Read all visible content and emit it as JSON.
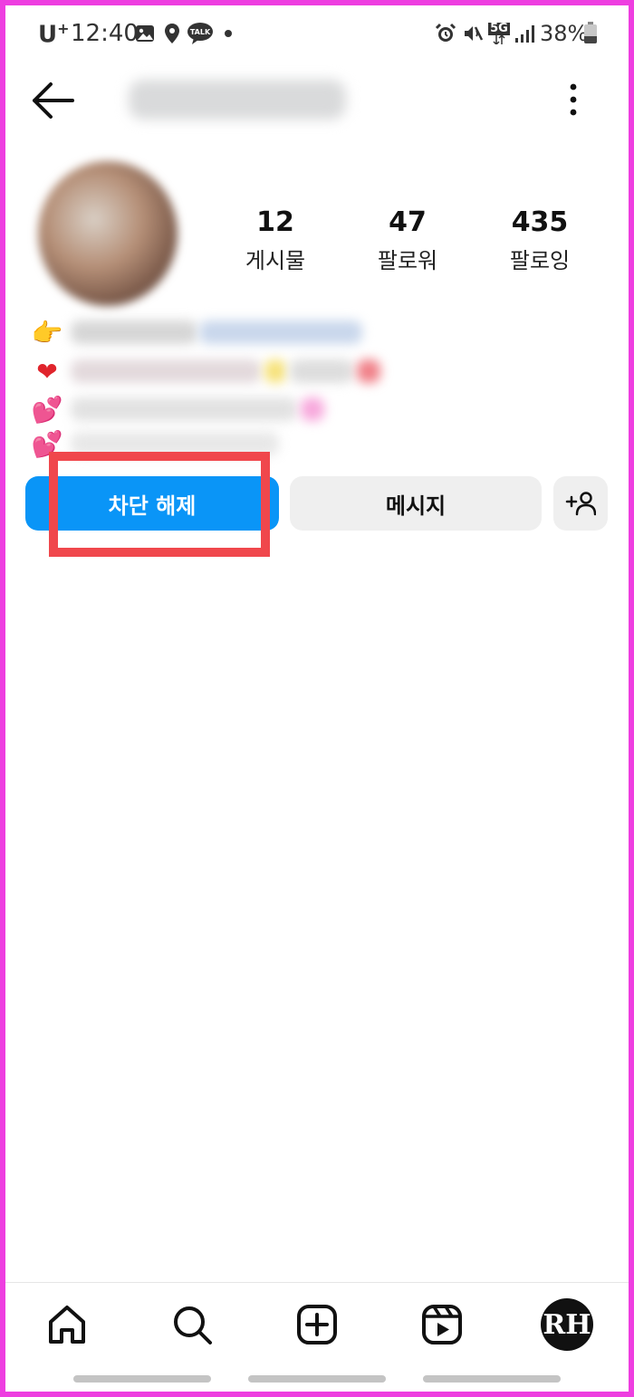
{
  "status_bar": {
    "carrier": "U",
    "carrier_sup": "+",
    "time": "12:40",
    "battery": "38%",
    "network": "5G",
    "icons": [
      "gallery-icon",
      "location-icon",
      "kakaotalk-icon",
      "dot-icon",
      "alarm-icon",
      "mute-icon",
      "5g-icon",
      "signal-icon",
      "battery-icon"
    ],
    "talk_label": "TALK"
  },
  "header": {
    "username": "",
    "back_icon": "arrow-left-icon",
    "menu_icon": "more-vertical-icon"
  },
  "profile": {
    "stats": [
      {
        "value": "12",
        "label": "게시물"
      },
      {
        "value": "47",
        "label": "팔로워"
      },
      {
        "value": "435",
        "label": "팔로잉"
      }
    ],
    "bio_emojis": [
      "👉",
      "❤",
      "💕",
      "💕"
    ]
  },
  "actions": {
    "unblock_label": "차단 해제",
    "message_label": "메시지",
    "add_user_icon": "add-person-icon"
  },
  "colors": {
    "primary_button": "#0a95f7",
    "secondary_button": "#efefef",
    "highlight": "#f0474c",
    "frame": "#ee3ee0"
  },
  "bottom_nav": {
    "items": [
      "home-icon",
      "search-icon",
      "create-icon",
      "reels-icon",
      "profile-avatar"
    ],
    "avatar_initials": "RH"
  }
}
